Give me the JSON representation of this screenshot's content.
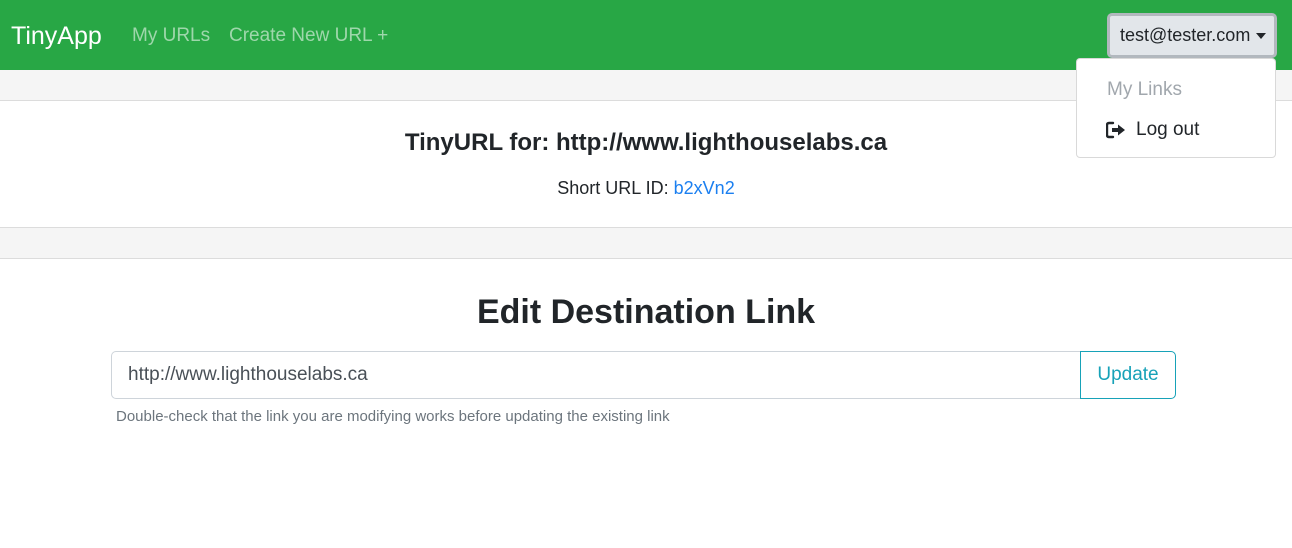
{
  "navbar": {
    "brand": "TinyApp",
    "links": [
      {
        "label": "My URLs"
      },
      {
        "label": "Create New URL +"
      }
    ],
    "user_email": "test@tester.com"
  },
  "dropdown": {
    "items": [
      {
        "label": "My Links",
        "disabled": true
      },
      {
        "label": "Log out",
        "icon": "sign-out-icon"
      }
    ]
  },
  "url_info": {
    "title": "TinyURL for: http://www.lighthouselabs.ca",
    "short_prefix": "Short URL ID: ",
    "short_id": "b2xVn2"
  },
  "edit": {
    "heading": "Edit Destination Link",
    "input_value": "http://www.lighthouselabs.ca",
    "button_label": "Update",
    "help_text": "Double-check that the link you are modifying works before updating the existing link"
  },
  "colors": {
    "navbar_bg": "#28a745",
    "link_color": "#1b7ff0",
    "update_outline": "#17a2b8"
  }
}
